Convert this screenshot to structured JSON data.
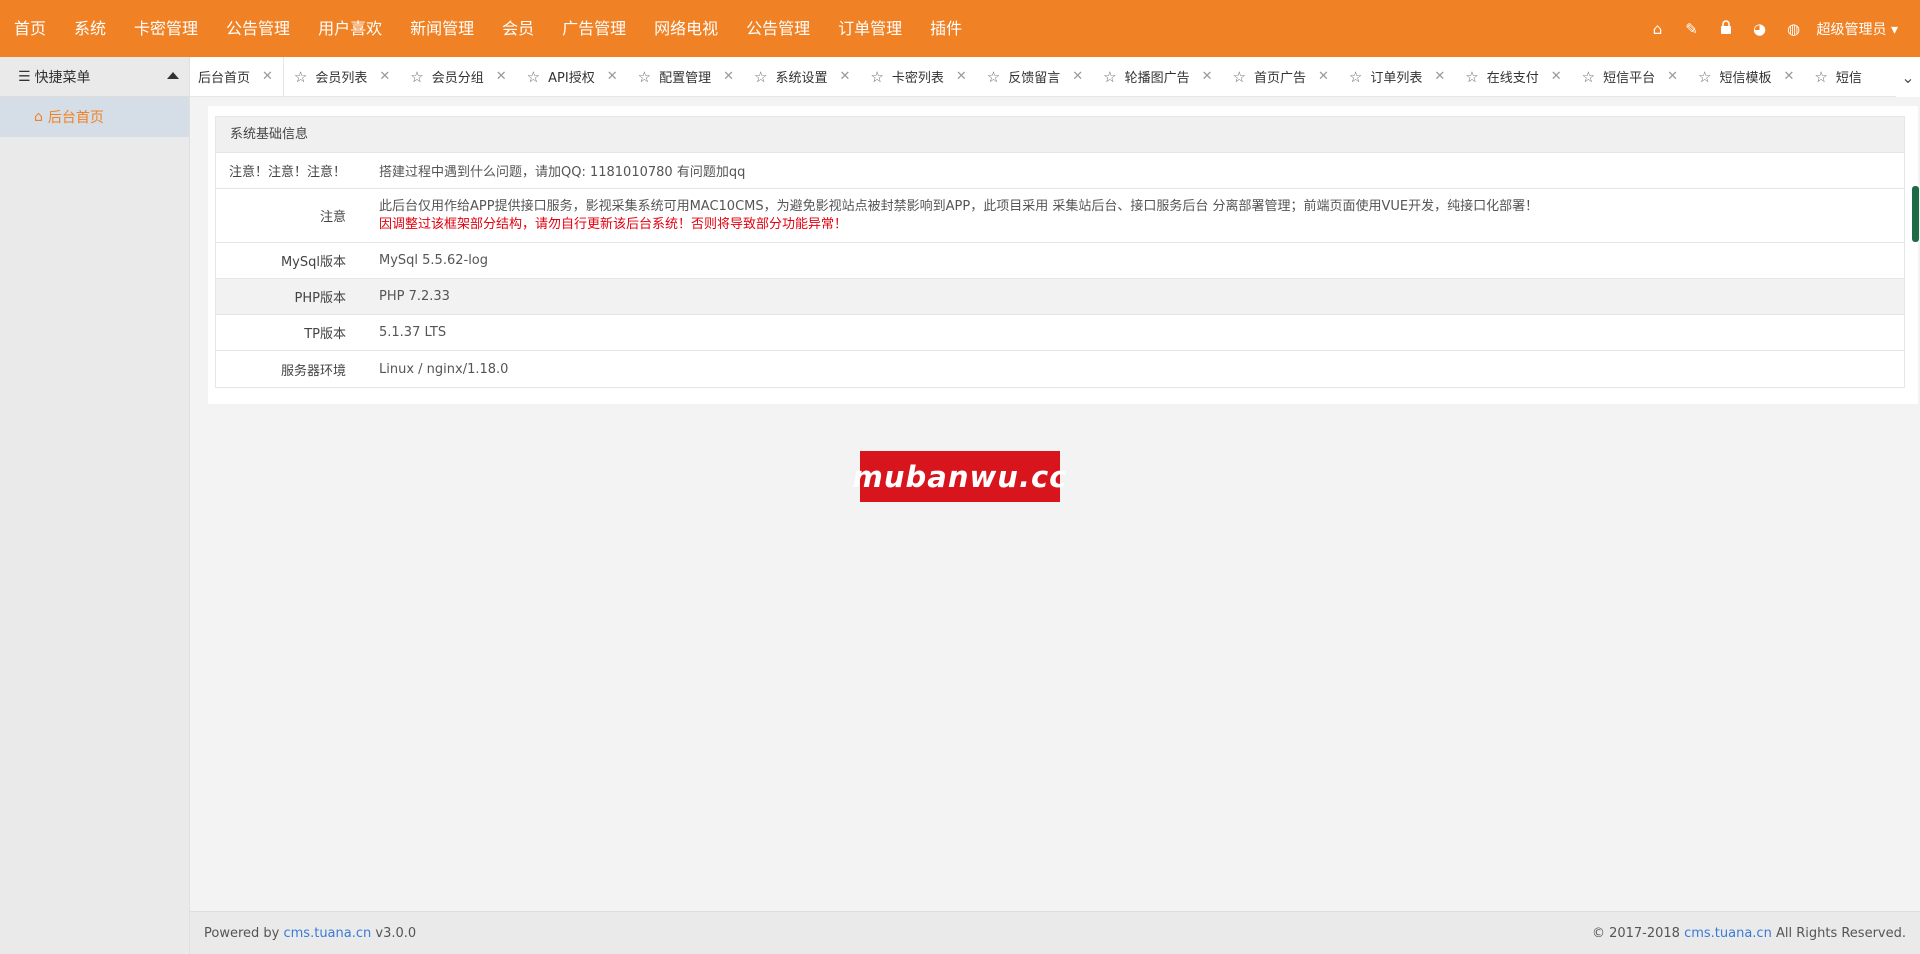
{
  "topnav": {
    "items": [
      "首页",
      "系统",
      "卡密管理",
      "公告管理",
      "用户喜欢",
      "新闻管理",
      "会员",
      "广告管理",
      "网络电视",
      "公告管理",
      "订单管理",
      "插件"
    ],
    "icons": [
      "home-icon",
      "broom-icon",
      "lock-icon",
      "palette-icon",
      "globe-icon"
    ],
    "admin": "超级管理员"
  },
  "sidebar": {
    "header": "快捷菜单",
    "items": [
      {
        "label": "后台首页",
        "icon": "home-icon"
      }
    ]
  },
  "tabs": [
    {
      "label": "后台首页",
      "active": true
    },
    {
      "label": "会员列表"
    },
    {
      "label": "会员分组"
    },
    {
      "label": "API授权"
    },
    {
      "label": "配置管理"
    },
    {
      "label": "系统设置"
    },
    {
      "label": "卡密列表"
    },
    {
      "label": "反馈留言"
    },
    {
      "label": "轮播图广告"
    },
    {
      "label": "首页广告"
    },
    {
      "label": "订单列表"
    },
    {
      "label": "在线支付"
    },
    {
      "label": "短信平台"
    },
    {
      "label": "短信模板"
    },
    {
      "label": "短信"
    }
  ],
  "info": {
    "title": "系统基础信息",
    "rows": {
      "notice_label": "注意！注意！注意！",
      "notice_value": "搭建过程中遇到什么问题，请加QQ: 1181010780 有问题加qq",
      "caution_label": "注意",
      "caution_line1": "此后台仅用作给APP提供接口服务，影视采集系统可用MAC10CMS，为避免影视站点被封禁影响到APP，此项目采用 采集站后台、接口服务后台 分离部署管理；前端页面使用VUE开发，纯接口化部署！",
      "caution_line2": "因调整过该框架部分结构，请勿自行更新该后台系统！否则将导致部分功能异常！",
      "mysql_label": "MySql版本",
      "mysql_value": "MySql 5.5.62-log",
      "php_label": "PHP版本",
      "php_value": "PHP 7.2.33",
      "tp_label": "TP版本",
      "tp_value": "5.1.37 LTS",
      "server_label": "服务器环境",
      "server_value": "Linux / nginx/1.18.0"
    }
  },
  "watermark": "mubanwu.cc",
  "footer": {
    "powered_prefix": "Powered by",
    "powered_link": "cms.tuana.cn",
    "version": "v3.0.0",
    "copyright_prefix": "© 2017-2018",
    "copyright_link": "cms.tuana.cn",
    "copyright_suffix": "All Rights Reserved."
  },
  "colors": {
    "accent": "#f08225",
    "red": "#e5000f",
    "link": "#3a7bd5"
  }
}
